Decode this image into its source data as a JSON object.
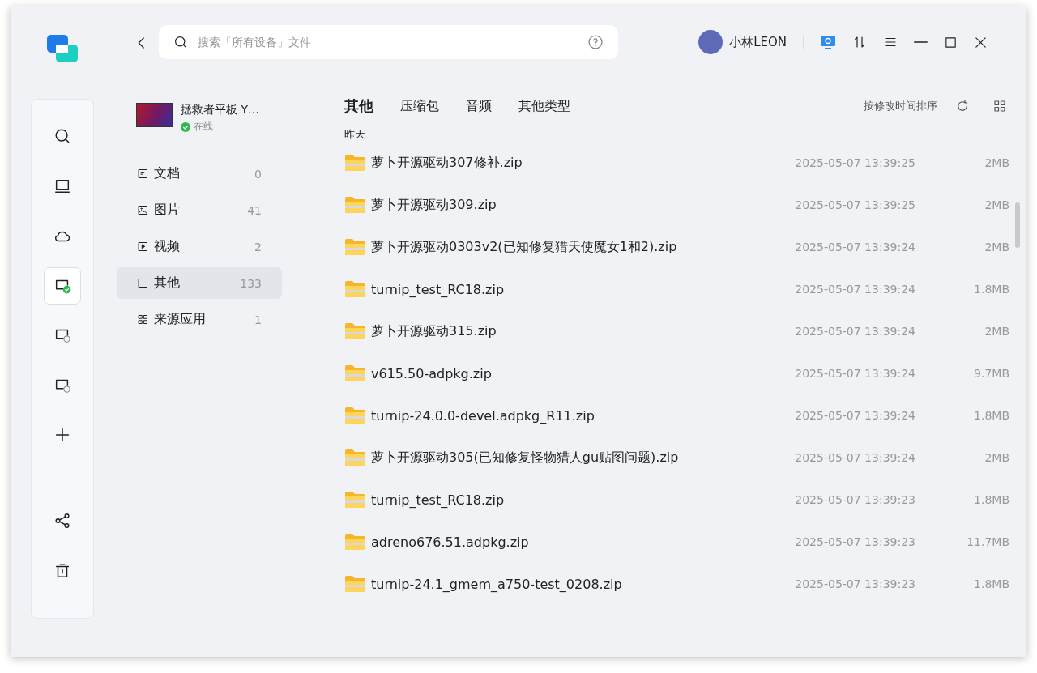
{
  "search": {
    "placeholder": "搜索「所有设备」文件"
  },
  "user": {
    "name": "小林LEON"
  },
  "rail": [
    {
      "kind": "search",
      "selected": false
    },
    {
      "kind": "computer",
      "selected": false
    },
    {
      "kind": "cloud",
      "selected": false
    },
    {
      "kind": "device-online",
      "selected": true
    },
    {
      "kind": "device-offline",
      "selected": false
    },
    {
      "kind": "device-offline",
      "selected": false
    },
    {
      "kind": "add",
      "selected": false
    }
  ],
  "rail_bottom": [
    {
      "kind": "share"
    },
    {
      "kind": "trash"
    }
  ],
  "device": {
    "name": "拯救者平板 Y…",
    "status": "在线"
  },
  "categories": [
    {
      "kind": "doc",
      "label": "文档",
      "count": "0",
      "selected": false
    },
    {
      "kind": "image",
      "label": "图片",
      "count": "41",
      "selected": false
    },
    {
      "kind": "video",
      "label": "视频",
      "count": "2",
      "selected": false
    },
    {
      "kind": "other",
      "label": "其他",
      "count": "133",
      "selected": true
    },
    {
      "kind": "apps",
      "label": "来源应用",
      "count": "1",
      "selected": false
    }
  ],
  "tabs": [
    {
      "label": "其他",
      "selected": true
    },
    {
      "label": "压缩包",
      "selected": false
    },
    {
      "label": "音频",
      "selected": false
    },
    {
      "label": "其他类型",
      "selected": false
    }
  ],
  "sort_label": "按修改时间排序",
  "group_label": "昨天",
  "files": [
    {
      "name": "萝卜开源驱动307修补.zip",
      "modified": "2025-05-07 13:39:25",
      "size": "2MB"
    },
    {
      "name": "萝卜开源驱动309.zip",
      "modified": "2025-05-07 13:39:25",
      "size": "2MB"
    },
    {
      "name": "萝卜开源驱动0303v2(已知修复猎天使魔女1和2).zip",
      "modified": "2025-05-07 13:39:24",
      "size": "2MB"
    },
    {
      "name": "turnip_test_RC18.zip",
      "modified": "2025-05-07 13:39:24",
      "size": "1.8MB"
    },
    {
      "name": "萝卜开源驱动315.zip",
      "modified": "2025-05-07 13:39:24",
      "size": "2MB"
    },
    {
      "name": "v615.50-adpkg.zip",
      "modified": "2025-05-07 13:39:24",
      "size": "9.7MB"
    },
    {
      "name": "turnip-24.0.0-devel.adpkg_R11.zip",
      "modified": "2025-05-07 13:39:24",
      "size": "1.8MB"
    },
    {
      "name": "萝卜开源驱动305(已知修复怪物猎人gu贴图问题).zip",
      "modified": "2025-05-07 13:39:24",
      "size": "2MB"
    },
    {
      "name": "turnip_test_RC18.zip",
      "modified": "2025-05-07 13:39:23",
      "size": "1.8MB"
    },
    {
      "name": "adreno676.51.adpkg.zip",
      "modified": "2025-05-07 13:39:23",
      "size": "11.7MB"
    },
    {
      "name": "turnip-24.1_gmem_a750-test_0208.zip",
      "modified": "2025-05-07 13:39:23",
      "size": "1.8MB"
    }
  ]
}
